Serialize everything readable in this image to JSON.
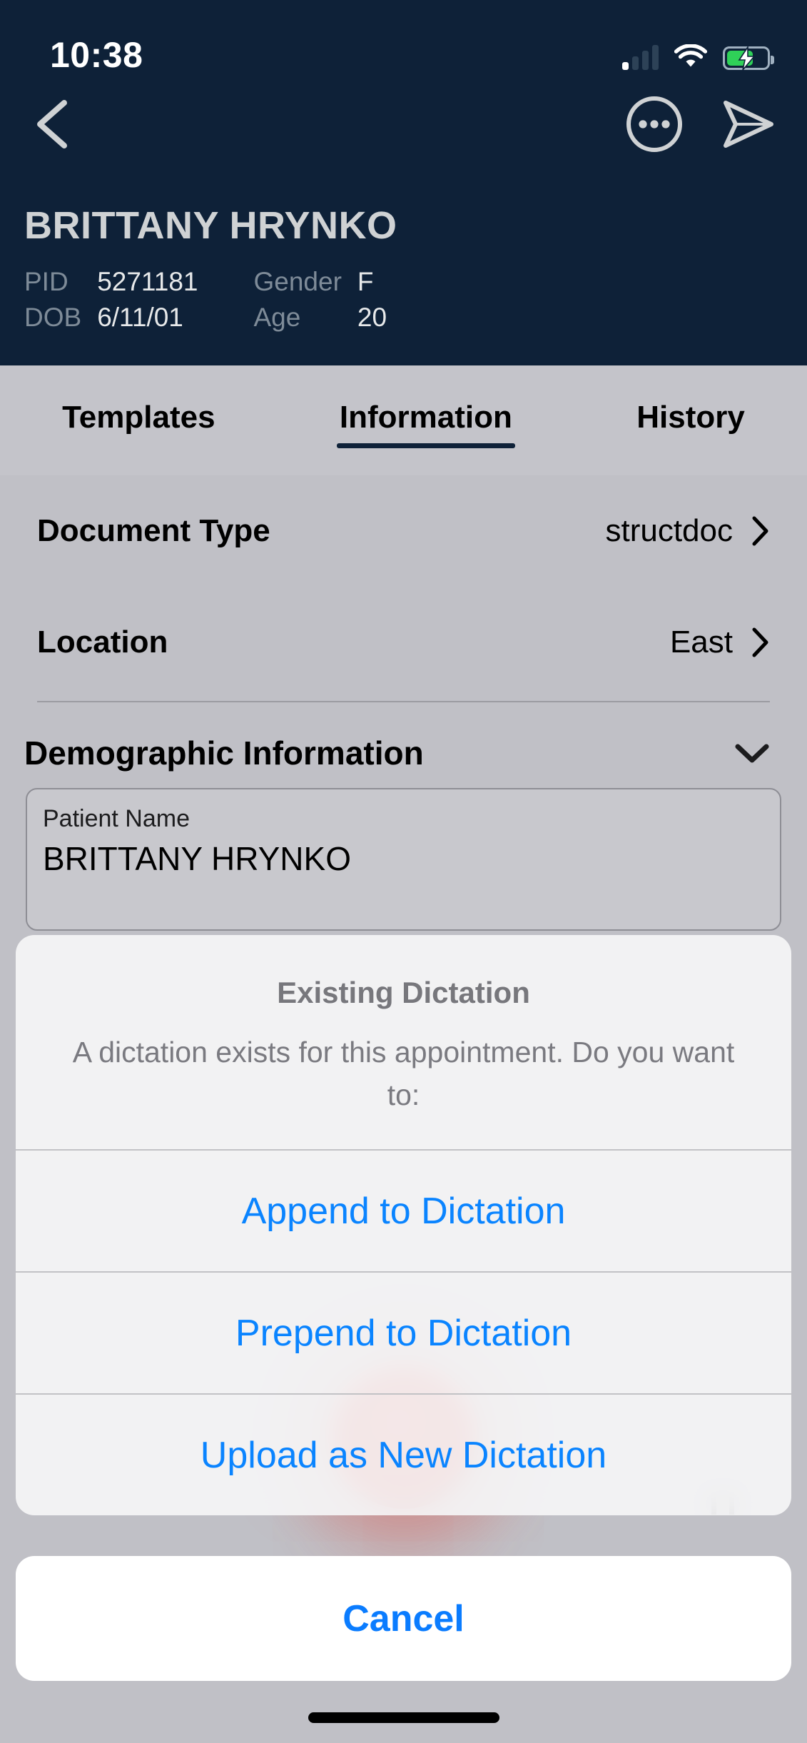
{
  "status_bar": {
    "time": "10:38",
    "signal_icon": "cellular-signal-icon",
    "wifi_icon": "wifi-icon",
    "battery_icon": "battery-charging-icon"
  },
  "header": {
    "back_icon": "back-chevron-icon",
    "more_icon": "more-options-icon",
    "send_icon": "send-icon",
    "patient_name": "BRITTANY HRYNKO",
    "fields": [
      {
        "key": "PID",
        "value": "5271181"
      },
      {
        "key": "DOB",
        "value": "6/11/01"
      },
      {
        "key": "Gender",
        "value": "F"
      },
      {
        "key": "Age",
        "value": "20"
      }
    ]
  },
  "tabs": [
    {
      "label": "Templates",
      "active": false
    },
    {
      "label": "Information",
      "active": true
    },
    {
      "label": "History",
      "active": false
    }
  ],
  "form": {
    "rows": [
      {
        "label": "Document Type",
        "value": "structdoc",
        "chevron": "chevron-right-icon"
      },
      {
        "label": "Location",
        "value": "East",
        "chevron": "chevron-right-icon"
      }
    ],
    "section": {
      "title": "Demographic Information",
      "chevron": "chevron-down-icon"
    },
    "patient_name_field": {
      "label": "Patient Name",
      "value": "BRITTANY HRYNKO"
    }
  },
  "recorder": {
    "record_button": "record-button",
    "pause_icon": "pause-icon"
  },
  "action_sheet": {
    "title": "Existing Dictation",
    "message": "A dictation exists for this appointment. Do you want to:",
    "options": [
      {
        "label": "Append to Dictation"
      },
      {
        "label": "Prepend to Dictation"
      },
      {
        "label": "Upload as New Dictation"
      }
    ],
    "cancel_label": "Cancel"
  },
  "colors": {
    "header_navy": "#0e2138",
    "page_gray": "#c0c0c6",
    "tab_gray": "#c4c4ca",
    "link_blue": "#0a84ff",
    "record_red": "#c9231c",
    "battery_green": "#2fd158"
  }
}
